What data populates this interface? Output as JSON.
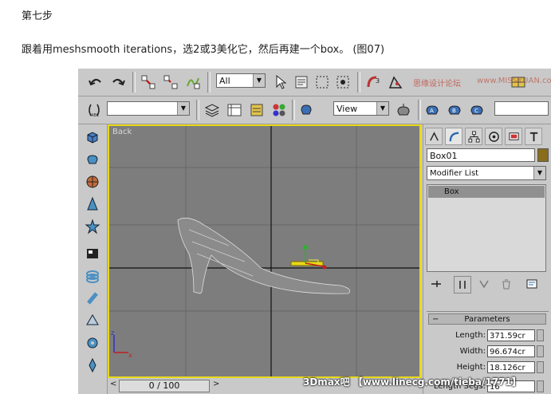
{
  "article": {
    "step": "第七步",
    "text": "跟着用meshsmooth iterations，选2或3美化它，然后再建一个box。 (图07)"
  },
  "toolbar1": {
    "selection_filter": "All"
  },
  "toolbar2": {
    "named_selection": "",
    "view_dropdown": "View"
  },
  "viewport": {
    "label": "Back",
    "watermark_1": "思缘设计论坛",
    "watermark_2": "www.MISSYUAN.com"
  },
  "time_slider": {
    "frame": "0 / 100",
    "left_arrow": "<",
    "right_arrow": ">"
  },
  "command_panel": {
    "object_name": "Box01",
    "modifier_list": "Modifier List",
    "stack_items": [
      "Box"
    ],
    "parameters_title": "Parameters",
    "params": [
      {
        "label": "Length:",
        "value": "371.59cr"
      },
      {
        "label": "Width:",
        "value": "96.674cr"
      },
      {
        "label": "Height:",
        "value": "18.126cr"
      },
      {
        "label": "Length Segs:",
        "value": "16"
      }
    ]
  },
  "caption": "3Dmax吧 【www.linecg.com/tieba/1771】",
  "colors": {
    "viewport_bg": "#7d7d7d",
    "active_viewport_border": "#e8d91a",
    "panel_bg": "#c9c9c9",
    "stack_selected": "#909090",
    "object_color": "#8a6d1c"
  }
}
